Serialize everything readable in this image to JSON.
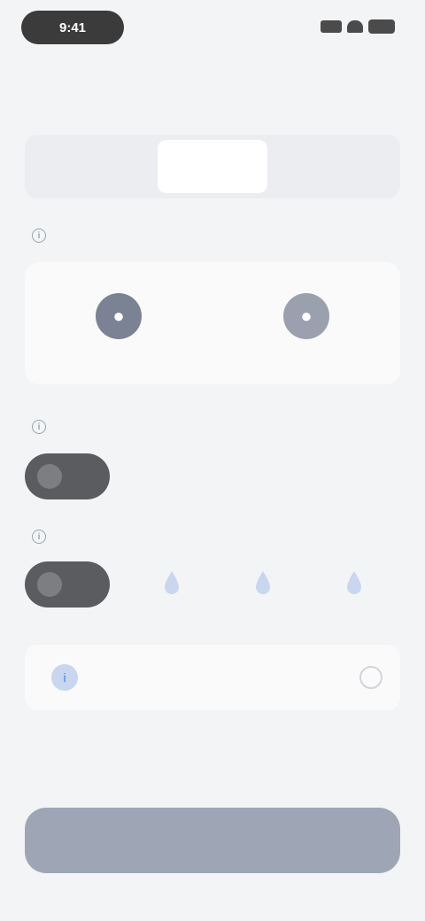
{
  "status_bar": {
    "time": "9:41",
    "icons": [
      "signal-icon",
      "wifi-icon",
      "battery-icon"
    ]
  },
  "header": {
    "title": "",
    "action_label": ""
  },
  "segment": {
    "items": [
      {
        "label": ""
      },
      {
        "label": ""
      },
      {
        "label": ""
      }
    ],
    "active_index": 1
  },
  "sections": {
    "mode_label": "",
    "level_label": "",
    "flow_label": ""
  },
  "options": [
    {
      "label": "",
      "icon": "option-icon"
    },
    {
      "label": "",
      "icon": "option-icon"
    }
  ],
  "levels": [
    "",
    "",
    ""
  ],
  "setting": {
    "label": "",
    "badge_icon": "info-icon"
  },
  "primary_button": {
    "label": ""
  },
  "colors": {
    "background": "#f3f4f6",
    "card": "#fafafa",
    "toggle": "#5a5c5f",
    "button": "#9ea6b6",
    "accent": "#3b82f6"
  }
}
